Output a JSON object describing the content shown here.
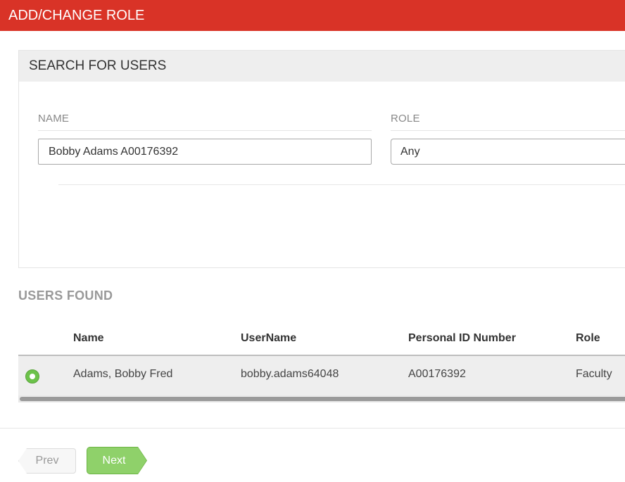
{
  "header": {
    "title": "ADD/CHANGE ROLE"
  },
  "search": {
    "title": "SEARCH FOR USERS",
    "name_label": "NAME",
    "name_value": "Bobby Adams A00176392",
    "role_label": "ROLE",
    "role_value": "Any"
  },
  "results": {
    "title": "USERS FOUND",
    "columns": [
      "Name",
      "UserName",
      "Personal ID Number",
      "Role"
    ],
    "rows": [
      {
        "selected": true,
        "name": "Adams, Bobby Fred",
        "username": "bobby.adams64048",
        "personal_id": "A00176392",
        "role": "Faculty"
      }
    ]
  },
  "nav": {
    "prev_label": "Prev",
    "next_label": "Next"
  },
  "colors": {
    "header": "#d93327",
    "accent_green": "#8fd16a",
    "radio_green": "#6cc24a"
  }
}
